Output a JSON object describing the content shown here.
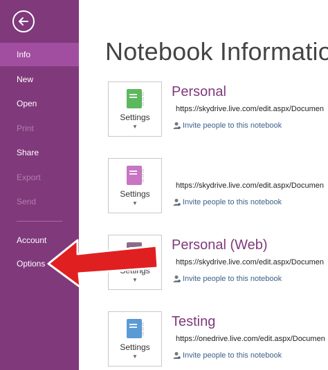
{
  "sidebar": {
    "items": [
      {
        "label": "Info",
        "state": "active"
      },
      {
        "label": "New",
        "state": "normal"
      },
      {
        "label": "Open",
        "state": "normal"
      },
      {
        "label": "Print",
        "state": "disabled"
      },
      {
        "label": "Share",
        "state": "normal"
      },
      {
        "label": "Export",
        "state": "disabled"
      },
      {
        "label": "Send",
        "state": "disabled"
      },
      {
        "label": "Account",
        "state": "normal"
      },
      {
        "label": "Options",
        "state": "normal"
      }
    ]
  },
  "main": {
    "title": "Notebook Informatio",
    "notebooks": [
      {
        "name": "Personal",
        "url": "https://skydrive.live.com/edit.aspx/Documen",
        "settings": "Settings",
        "invite": "Invite people to this notebook",
        "color": "#5cb85c"
      },
      {
        "name": "",
        "url": "https://skydrive.live.com/edit.aspx/Documen",
        "settings": "Settings",
        "invite": "Invite people to this notebook",
        "color": "#c875c4"
      },
      {
        "name": "Personal (Web)",
        "url": "https://skydrive.live.com/edit.aspx/Documen",
        "settings": "Settings",
        "invite": "Invite people to this notebook",
        "color": "#8a6b8a"
      },
      {
        "name": "Testing",
        "url": "https://onedrive.live.com/edit.aspx/Documen",
        "settings": "Settings",
        "invite": "Invite people to this notebook",
        "color": "#5b9bd5"
      }
    ]
  },
  "colors": {
    "sidebar": "#80397b",
    "active": "#a14ea0",
    "accent_name": "#80397b",
    "arrow": "#e02020"
  }
}
